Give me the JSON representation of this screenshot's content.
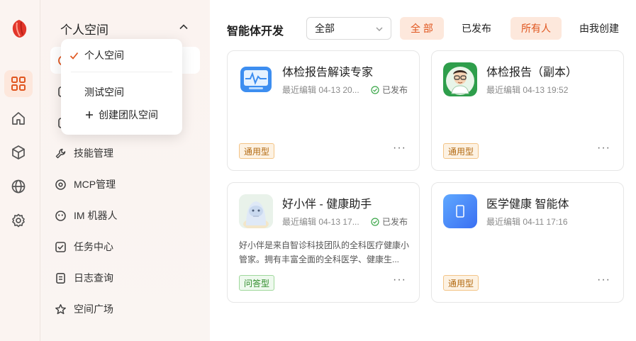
{
  "rail": {
    "items": [
      {
        "name": "apps",
        "active": true
      },
      {
        "name": "home",
        "active": false
      },
      {
        "name": "cube",
        "active": false
      },
      {
        "name": "globe",
        "active": false
      },
      {
        "name": "settings",
        "active": false
      }
    ]
  },
  "sidebar": {
    "space_title": "个人空间",
    "items": [
      {
        "label": "技能管理",
        "icon": "wrench-icon"
      },
      {
        "label": "MCP管理",
        "icon": "target-icon"
      },
      {
        "label": "IM 机器人",
        "icon": "robot-icon"
      },
      {
        "label": "任务中心",
        "icon": "task-check-icon"
      },
      {
        "label": "日志查询",
        "icon": "log-document-icon"
      },
      {
        "label": "空间广场",
        "icon": "star-icon"
      }
    ]
  },
  "dropdown": {
    "selected": "个人空间",
    "other": "测试空间",
    "create": "创建团队空间"
  },
  "main": {
    "title": "智能体开发",
    "select_value": "全部",
    "chips": [
      {
        "label": "全 部",
        "active": true
      },
      {
        "label": "已发布",
        "active": false
      },
      {
        "label": "所有人",
        "active": true
      },
      {
        "label": "由我创建",
        "active": false
      }
    ],
    "cards": [
      {
        "title": "体检报告解读专家",
        "meta": "最近编辑 04-13 20...",
        "status": "已发布",
        "desc": "",
        "tag": "通用型",
        "tag_color": "orange"
      },
      {
        "title": "体检报告（副本）",
        "meta": "最近编辑 04-13 19:52",
        "status": "",
        "desc": "",
        "tag": "通用型",
        "tag_color": "orange"
      },
      {
        "title": "好小伴 - 健康助手",
        "meta": "最近编辑 04-13 17...",
        "status": "已发布",
        "desc": "好小伴是来自智诊科技团队的全科医疗健康小管家。拥有丰富全面的全科医学、健康生...",
        "tag": "问答型",
        "tag_color": "green"
      },
      {
        "title": "医学健康 智能体",
        "meta": "最近编辑 04-11 17:16",
        "status": "",
        "desc": "",
        "tag": "通用型",
        "tag_color": "orange"
      }
    ],
    "more_label": "···"
  },
  "colors": {
    "accent": "#e0561f",
    "accent_bg": "#fde8dc"
  }
}
